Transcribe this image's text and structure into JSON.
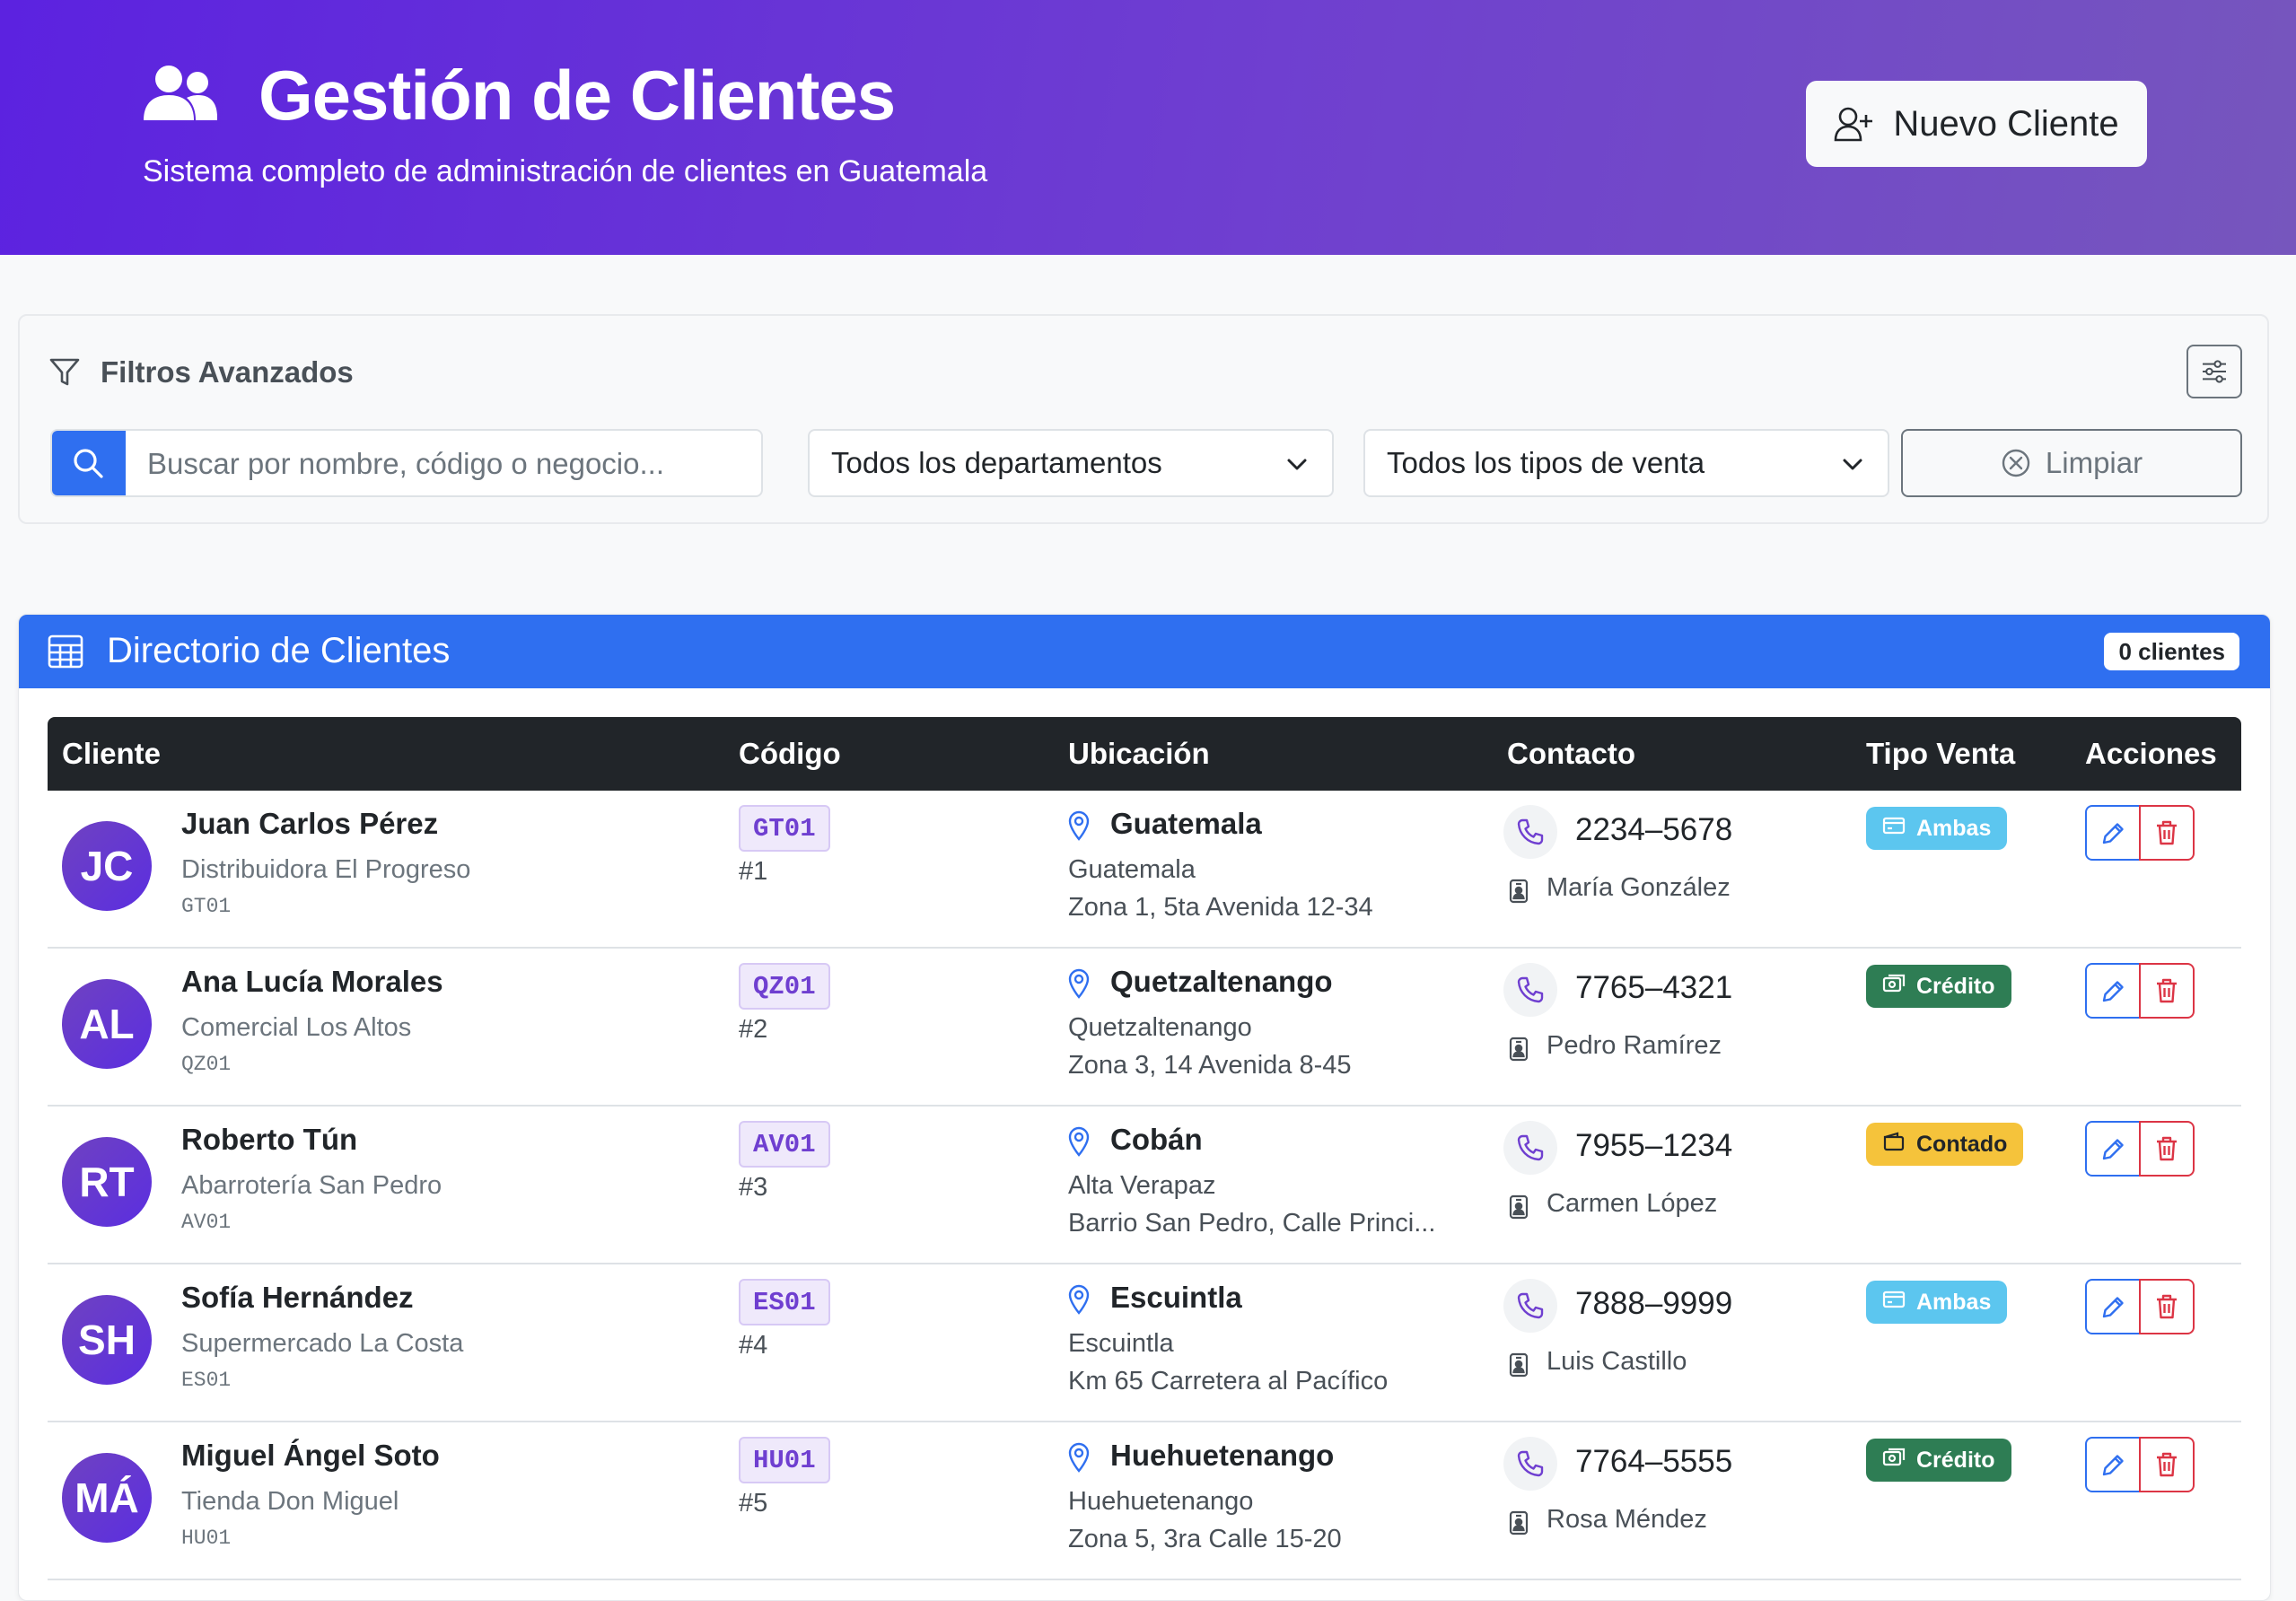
{
  "header": {
    "title": "Gestión de Clientes",
    "subtitle": "Sistema completo de administración de clientes en Guatemala",
    "new_button_label": "Nuevo Cliente"
  },
  "filters": {
    "title": "Filtros Avanzados",
    "search_placeholder": "Buscar por nombre, código o negocio...",
    "department_select": "Todos los departamentos",
    "sale_type_select": "Todos los tipos de venta",
    "clear_label": "Limpiar"
  },
  "directory": {
    "title": "Directorio de Clientes",
    "count_badge": "0 clientes",
    "columns": [
      "Cliente",
      "Código",
      "Ubicación",
      "Contacto",
      "Tipo Venta",
      "Acciones"
    ],
    "rows": [
      {
        "initials": "JC",
        "name": "Juan Carlos Pérez",
        "business": "Distribuidora El Progreso",
        "code": "GT01",
        "number": "#1",
        "city": "Guatemala",
        "department": "Guatemala",
        "address": "Zona 1, 5ta Avenida 12-34",
        "phone": "2234–5678",
        "contact": "María González",
        "sale_type": "Ambas",
        "sale_kind": "ambas"
      },
      {
        "initials": "AL",
        "name": "Ana Lucía Morales",
        "business": "Comercial Los Altos",
        "code": "QZ01",
        "number": "#2",
        "city": "Quetzaltenango",
        "department": "Quetzaltenango",
        "address": "Zona 3, 14 Avenida 8-45",
        "phone": "7765–4321",
        "contact": "Pedro Ramírez",
        "sale_type": "Crédito",
        "sale_kind": "credito"
      },
      {
        "initials": "RT",
        "name": "Roberto Tún",
        "business": "Abarrotería San Pedro",
        "code": "AV01",
        "number": "#3",
        "city": "Cobán",
        "department": "Alta Verapaz",
        "address": "Barrio San Pedro, Calle Princi...",
        "phone": "7955–1234",
        "contact": "Carmen López",
        "sale_type": "Contado",
        "sale_kind": "contado"
      },
      {
        "initials": "SH",
        "name": "Sofía Hernández",
        "business": "Supermercado La Costa",
        "code": "ES01",
        "number": "#4",
        "city": "Escuintla",
        "department": "Escuintla",
        "address": "Km 65 Carretera al Pacífico",
        "phone": "7888–9999",
        "contact": "Luis Castillo",
        "sale_type": "Ambas",
        "sale_kind": "ambas"
      },
      {
        "initials": "MÁ",
        "name": "Miguel Ángel Soto",
        "business": "Tienda Don Miguel",
        "code": "HU01",
        "number": "#5",
        "city": "Huehuetenango",
        "department": "Huehuetenango",
        "address": "Zona 5, 3ra Calle 15-20",
        "phone": "7764–5555",
        "contact": "Rosa Méndez",
        "sale_type": "Crédito",
        "sale_kind": "credito"
      }
    ]
  },
  "colors": {
    "header_gradient_start": "#5c22e0",
    "header_gradient_end": "#7656bd",
    "primary": "#2f6ff0",
    "danger": "#dc3545",
    "badge_ambas": "#5cc6ef",
    "badge_credito": "#2e7d54",
    "badge_contado": "#f5c33b"
  },
  "icons": {
    "header": "users-icon",
    "new_button": "person-plus-icon",
    "filters": "funnel-icon",
    "settings": "sliders-icon",
    "search": "search-icon",
    "clear": "x-circle-icon",
    "directory": "table-icon",
    "location": "map-pin-icon",
    "phone": "phone-icon",
    "contact": "person-badge-icon",
    "edit": "pencil-icon",
    "delete": "trash-icon"
  }
}
